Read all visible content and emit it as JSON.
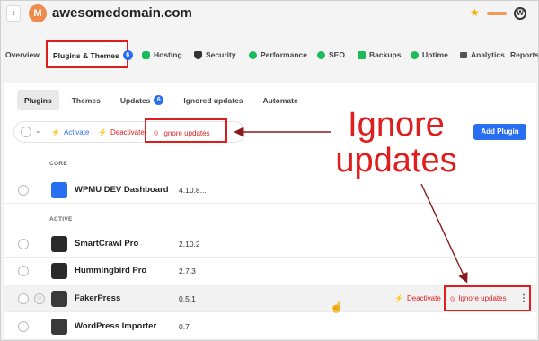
{
  "header": {
    "back_label": "‹",
    "avatar_letter": "M",
    "domain": "awesomedomain.com",
    "star_icon": "star-icon",
    "wp_icon_label": "W"
  },
  "main_nav": [
    {
      "label": "Overview",
      "icon": "",
      "color": ""
    },
    {
      "label": "Plugins & Themes",
      "badge": "6",
      "active": true
    },
    {
      "label": "Hosting",
      "icon": "cloud-icon",
      "color": "#1abc5a"
    },
    {
      "label": "Security",
      "icon": "shield-icon",
      "color": "#333333"
    },
    {
      "label": "Performance",
      "icon": "gauge-icon",
      "color": "#1abc5a"
    },
    {
      "label": "SEO",
      "icon": "seo-icon",
      "color": "#1abc5a"
    },
    {
      "label": "Backups",
      "icon": "backup-icon",
      "color": "#1abc5a"
    },
    {
      "label": "Uptime",
      "icon": "uptime-icon",
      "color": "#1abc5a"
    },
    {
      "label": "Analytics",
      "icon": "analytics-icon",
      "color": "#444444"
    },
    {
      "label": "Reports",
      "icon": "",
      "color": ""
    }
  ],
  "sub_tabs": [
    {
      "label": "Plugins",
      "active": true
    },
    {
      "label": "Themes"
    },
    {
      "label": "Updates",
      "badge": "6"
    },
    {
      "label": "Ignored updates"
    },
    {
      "label": "Automate"
    }
  ],
  "toolbar": {
    "activate": "Activate",
    "deactivate": "Deactivate",
    "ignore_updates": "Ignore updates",
    "kebab": "⋮",
    "add_plugin": "Add Plugin"
  },
  "annotation": {
    "line1": "Ignore",
    "line2": "updates"
  },
  "sections": {
    "core": "CORE",
    "active": "ACTIVE"
  },
  "plugins": [
    {
      "name": "WPMU DEV Dashboard",
      "version": "4.10.8...",
      "icon_color": "#286ef1"
    },
    {
      "name": "SmartCrawl Pro",
      "version": "2.10.2",
      "icon_color": "#2a2a2a"
    },
    {
      "name": "Hummingbird Pro",
      "version": "2.7.3",
      "icon_color": "#2a2a2a"
    },
    {
      "name": "FakerPress",
      "version": "0.5.1",
      "icon_color": "#3a3a3a"
    },
    {
      "name": "WordPress Importer",
      "version": "0.7",
      "icon_color": "#3a3a3a"
    }
  ],
  "row_actions": {
    "deactivate": "Deactivate",
    "ignore_updates": "Ignore updates",
    "kebab": "⋮"
  },
  "colors": {
    "accent_blue": "#286ef1",
    "highlight_red": "#e01e1e"
  }
}
